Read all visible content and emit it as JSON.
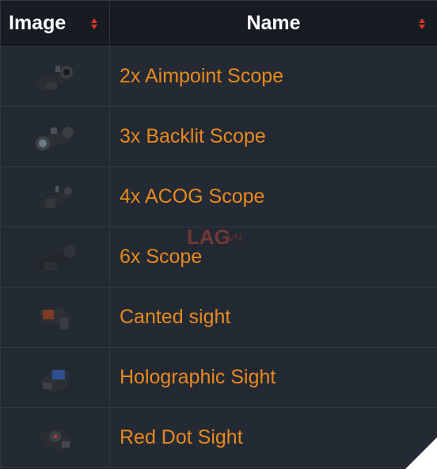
{
  "table": {
    "headers": {
      "image": "Image",
      "name": "Name"
    },
    "rows": [
      {
        "name": "2x Aimpoint Scope",
        "icon": "aimpoint-scope-icon"
      },
      {
        "name": "3x Backlit Scope",
        "icon": "backlit-scope-icon"
      },
      {
        "name": "4x ACOG Scope",
        "icon": "acog-scope-icon"
      },
      {
        "name": "6x Scope",
        "icon": "six-x-scope-icon"
      },
      {
        "name": "Canted sight",
        "icon": "canted-sight-icon"
      },
      {
        "name": "Holographic Sight",
        "icon": "holographic-sight-icon"
      },
      {
        "name": "Red Dot Sight",
        "icon": "red-dot-sight-icon"
      }
    ]
  },
  "watermark": {
    "brand": "LAG",
    "suffix": ".VN"
  },
  "colors": {
    "name_text": "#e8891d",
    "header_bg": "#171b22",
    "row_bg": "#242a33",
    "sort_arrow": "#d9352b"
  }
}
